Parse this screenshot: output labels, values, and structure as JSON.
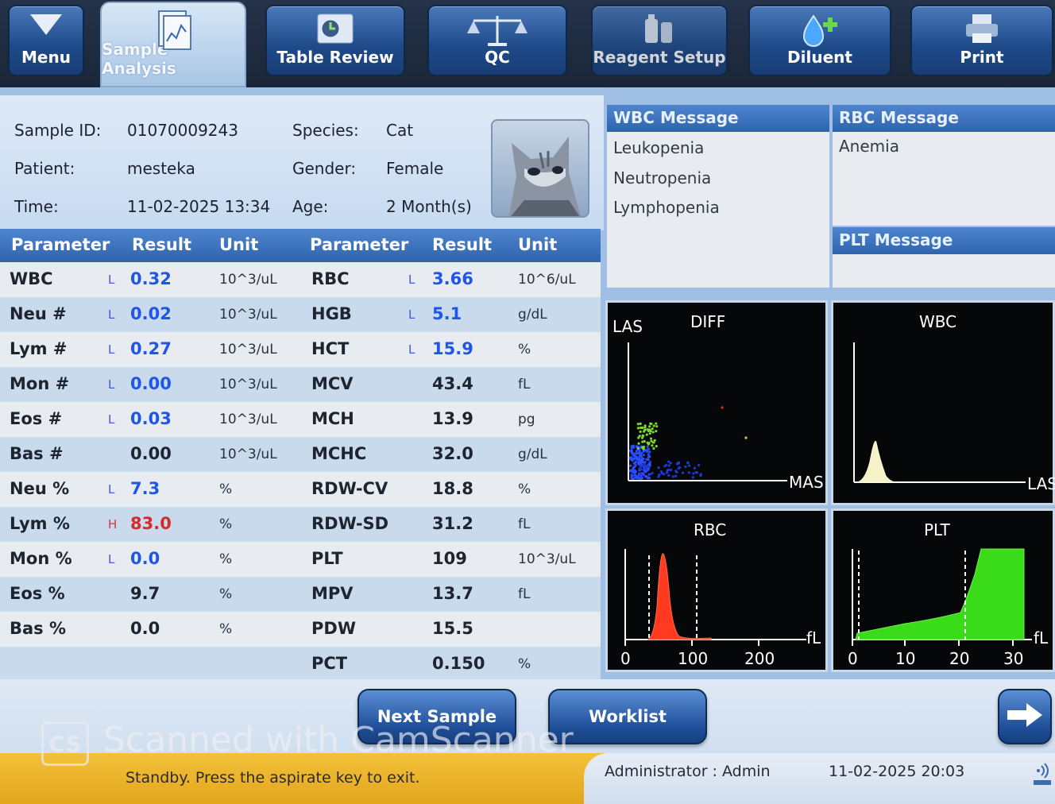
{
  "toolbar": {
    "menu": "Menu",
    "sample_analysis": "Sample Analysis",
    "table_review": "Table Review",
    "qc": "QC",
    "reagent_setup": "Reagent Setup",
    "diluent": "Diluent",
    "print": "Print"
  },
  "patient": {
    "sample_id_label": "Sample ID:",
    "sample_id": "01070009243",
    "patient_label": "Patient:",
    "patient": "mesteka",
    "time_label": "Time:",
    "time": "11-02-2025 13:34",
    "species_label": "Species:",
    "species": "Cat",
    "gender_label": "Gender:",
    "gender": "Female",
    "age_label": "Age:",
    "age": "2 Month(s)"
  },
  "table": {
    "headers": [
      "Parameter",
      "Result",
      "Unit",
      "Parameter",
      "Result",
      "Unit"
    ],
    "left": [
      {
        "name": "WBC",
        "flag": "L",
        "result": "0.32",
        "unit": "10^3/uL"
      },
      {
        "name": "Neu #",
        "flag": "L",
        "result": "0.02",
        "unit": "10^3/uL"
      },
      {
        "name": "Lym #",
        "flag": "L",
        "result": "0.27",
        "unit": "10^3/uL"
      },
      {
        "name": "Mon #",
        "flag": "L",
        "result": "0.00",
        "unit": "10^3/uL"
      },
      {
        "name": "Eos #",
        "flag": "L",
        "result": "0.03",
        "unit": "10^3/uL"
      },
      {
        "name": "Bas #",
        "flag": "",
        "result": "0.00",
        "unit": "10^3/uL"
      },
      {
        "name": "Neu %",
        "flag": "L",
        "result": "7.3",
        "unit": "%"
      },
      {
        "name": "Lym %",
        "flag": "H",
        "result": "83.0",
        "unit": "%"
      },
      {
        "name": "Mon %",
        "flag": "L",
        "result": "0.0",
        "unit": "%"
      },
      {
        "name": "Eos %",
        "flag": "",
        "result": "9.7",
        "unit": "%"
      },
      {
        "name": "Bas %",
        "flag": "",
        "result": "0.0",
        "unit": "%"
      },
      {
        "name": "",
        "flag": "",
        "result": "",
        "unit": ""
      }
    ],
    "right": [
      {
        "name": "RBC",
        "flag": "L",
        "result": "3.66",
        "unit": "10^6/uL"
      },
      {
        "name": "HGB",
        "flag": "L",
        "result": "5.1",
        "unit": "g/dL"
      },
      {
        "name": "HCT",
        "flag": "L",
        "result": "15.9",
        "unit": "%"
      },
      {
        "name": "MCV",
        "flag": "",
        "result": "43.4",
        "unit": "fL"
      },
      {
        "name": "MCH",
        "flag": "",
        "result": "13.9",
        "unit": "pg"
      },
      {
        "name": "MCHC",
        "flag": "",
        "result": "32.0",
        "unit": "g/dL"
      },
      {
        "name": "RDW-CV",
        "flag": "",
        "result": "18.8",
        "unit": "%"
      },
      {
        "name": "RDW-SD",
        "flag": "",
        "result": "31.2",
        "unit": "fL"
      },
      {
        "name": "PLT",
        "flag": "",
        "result": "109",
        "unit": "10^3/uL"
      },
      {
        "name": "MPV",
        "flag": "",
        "result": "13.7",
        "unit": "fL"
      },
      {
        "name": "PDW",
        "flag": "",
        "result": "15.5",
        "unit": ""
      },
      {
        "name": "PCT",
        "flag": "",
        "result": "0.150",
        "unit": "%"
      }
    ]
  },
  "messages": {
    "wbc_title": "WBC Message",
    "wbc_lines": [
      "Leukopenia",
      "Neutropenia",
      "Lymphopenia"
    ],
    "rbc_title": "RBC Message",
    "rbc_lines": [
      "Anemia"
    ],
    "plt_title": "PLT Message"
  },
  "graphs": {
    "diff": {
      "title": "DIFF",
      "y_label": "LAS",
      "x_label": "MAS"
    },
    "wbc": {
      "title": "WBC",
      "x_label": "LAS"
    },
    "rbc": {
      "title": "RBC",
      "unit": "fL",
      "ticks": [
        "0",
        "100",
        "200"
      ]
    },
    "plt": {
      "title": "PLT",
      "unit": "fL",
      "ticks": [
        "0",
        "10",
        "20",
        "30"
      ]
    }
  },
  "controls": {
    "next_sample": "Next Sample",
    "worklist": "Worklist"
  },
  "status": {
    "message": "Standby. Press the aspirate key to exit.",
    "user": "Administrator : Admin",
    "datetime": "11-02-2025 20:03"
  },
  "watermark": {
    "badge": "CS",
    "text": "Scanned with CamScanner"
  },
  "colors": {
    "low": "#1f55e8",
    "high": "#d42a2a",
    "rbc_curve": "#ff3a1e",
    "plt_curve": "#3adc1a",
    "wbc_curve": "#f4f2c6",
    "status_bar": "#e9b025"
  }
}
